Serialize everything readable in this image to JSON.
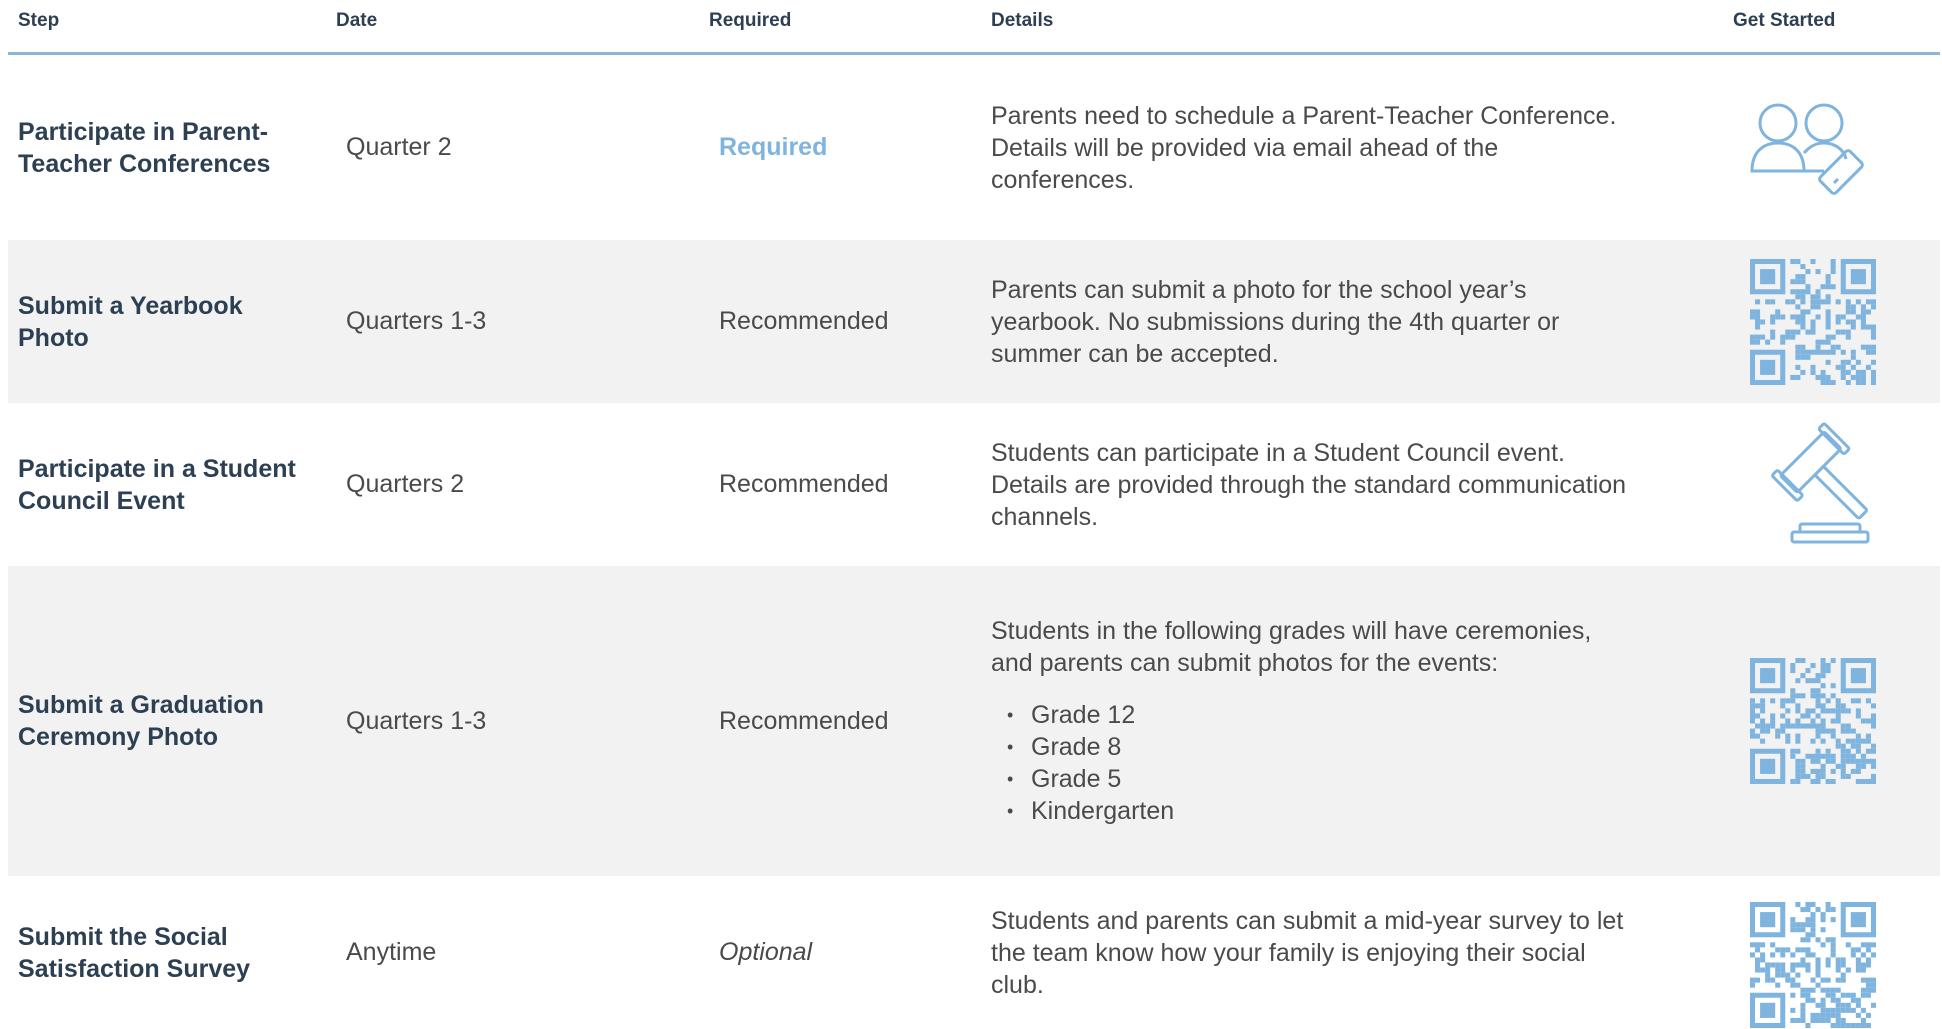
{
  "header": {
    "step": "Step",
    "date": "Date",
    "required": "Required",
    "details": "Details",
    "get_started": "Get Started"
  },
  "rows": [
    {
      "step": "Participate in Parent-Teacher Conferences",
      "date": "Quarter 2",
      "required": "Required",
      "details": "Parents need to schedule a Parent-Teacher Conference. Details will be provided via email ahead of the conferences.",
      "icon": "people-phone-icon"
    },
    {
      "step": "Submit a Yearbook Photo",
      "date": "Quarters 1-3",
      "required": "Recommended",
      "details": "Parents can submit a photo for the school year’s yearbook. No submissions during the 4th quarter or summer can be accepted.",
      "icon": "qr-code-icon"
    },
    {
      "step": "Participate in a Student Council Event",
      "date": "Quarters 2",
      "required": "Recommended",
      "details": "Students can participate in a Student Council event. Details are provided through the standard communication channels.",
      "icon": "gavel-icon"
    },
    {
      "step": "Submit a Graduation Ceremony Photo",
      "date": "Quarters 1-3",
      "required": "Recommended",
      "details": "Students in the following grades will have ceremonies, and parents can submit photos for the events:",
      "details_list": [
        "Grade 12",
        "Grade 8",
        "Grade 5",
        "Kindergarten"
      ],
      "icon": "qr-code-icon"
    },
    {
      "step": "Submit the Social Satisfaction Survey",
      "date": "Anytime",
      "required": "Optional",
      "details": "Students and parents can submit a mid-year survey to let the team know how your family is enjoying their social club.",
      "icon": "qr-code-icon"
    }
  ],
  "colors": {
    "accent": "#7fb4de",
    "header_rule": "#8fb5d4",
    "row_shade": "#f2f2f2",
    "text": "#2d3f52"
  }
}
